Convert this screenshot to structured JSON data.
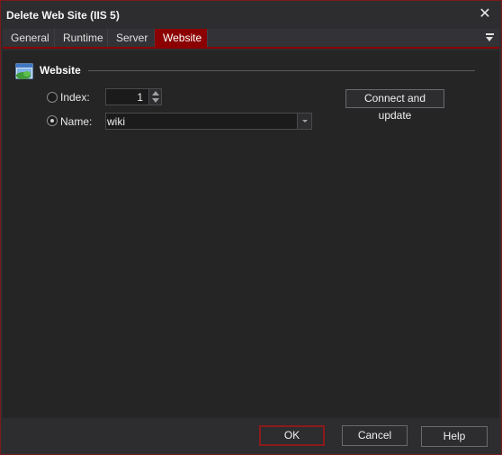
{
  "window": {
    "title": "Delete Web Site (IIS 5)",
    "close_glyph": "✕"
  },
  "tabs": [
    {
      "label": "General",
      "active": false
    },
    {
      "label": "Runtime",
      "active": false
    },
    {
      "label": "Server",
      "active": false
    },
    {
      "label": "Website",
      "active": true
    }
  ],
  "tab_menu_icon": "dropdown-menu-icon",
  "group": {
    "title": "Website",
    "icon": "website-globe-icon"
  },
  "form": {
    "index_label": "Index:",
    "index_value": "1",
    "index_selected": false,
    "name_label": "Name:",
    "name_value": "wiki",
    "name_selected": true,
    "connect_button": "Connect and update"
  },
  "footer": {
    "ok": "OK",
    "cancel": "Cancel",
    "help": "Help"
  },
  "colors": {
    "accent": "#8b0000",
    "background": "#252526",
    "chrome": "#2d2d30"
  }
}
